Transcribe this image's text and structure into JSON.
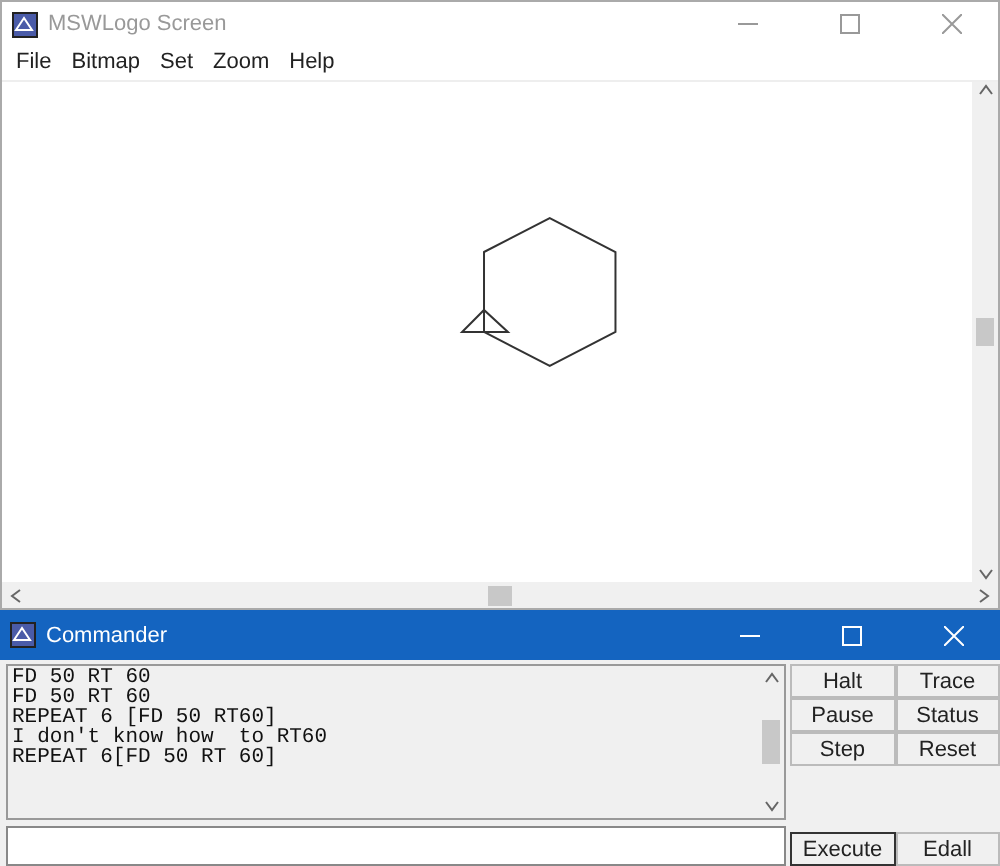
{
  "window": {
    "title": "MSWLogo Screen"
  },
  "menu": [
    "File",
    "Bitmap",
    "Set",
    "Zoom",
    "Help"
  ],
  "commander": {
    "title": "Commander",
    "history": [
      "FD 50 RT 60",
      "FD 50 RT 60",
      "REPEAT 6 [FD 50 RT60]",
      "I don't know how  to RT60",
      "REPEAT 6[FD 50 RT 60]"
    ],
    "buttons": [
      "Halt",
      "Trace",
      "Pause",
      "Status",
      "Step",
      "Reset"
    ],
    "bottom_buttons": [
      "Execute",
      "Edall"
    ]
  }
}
